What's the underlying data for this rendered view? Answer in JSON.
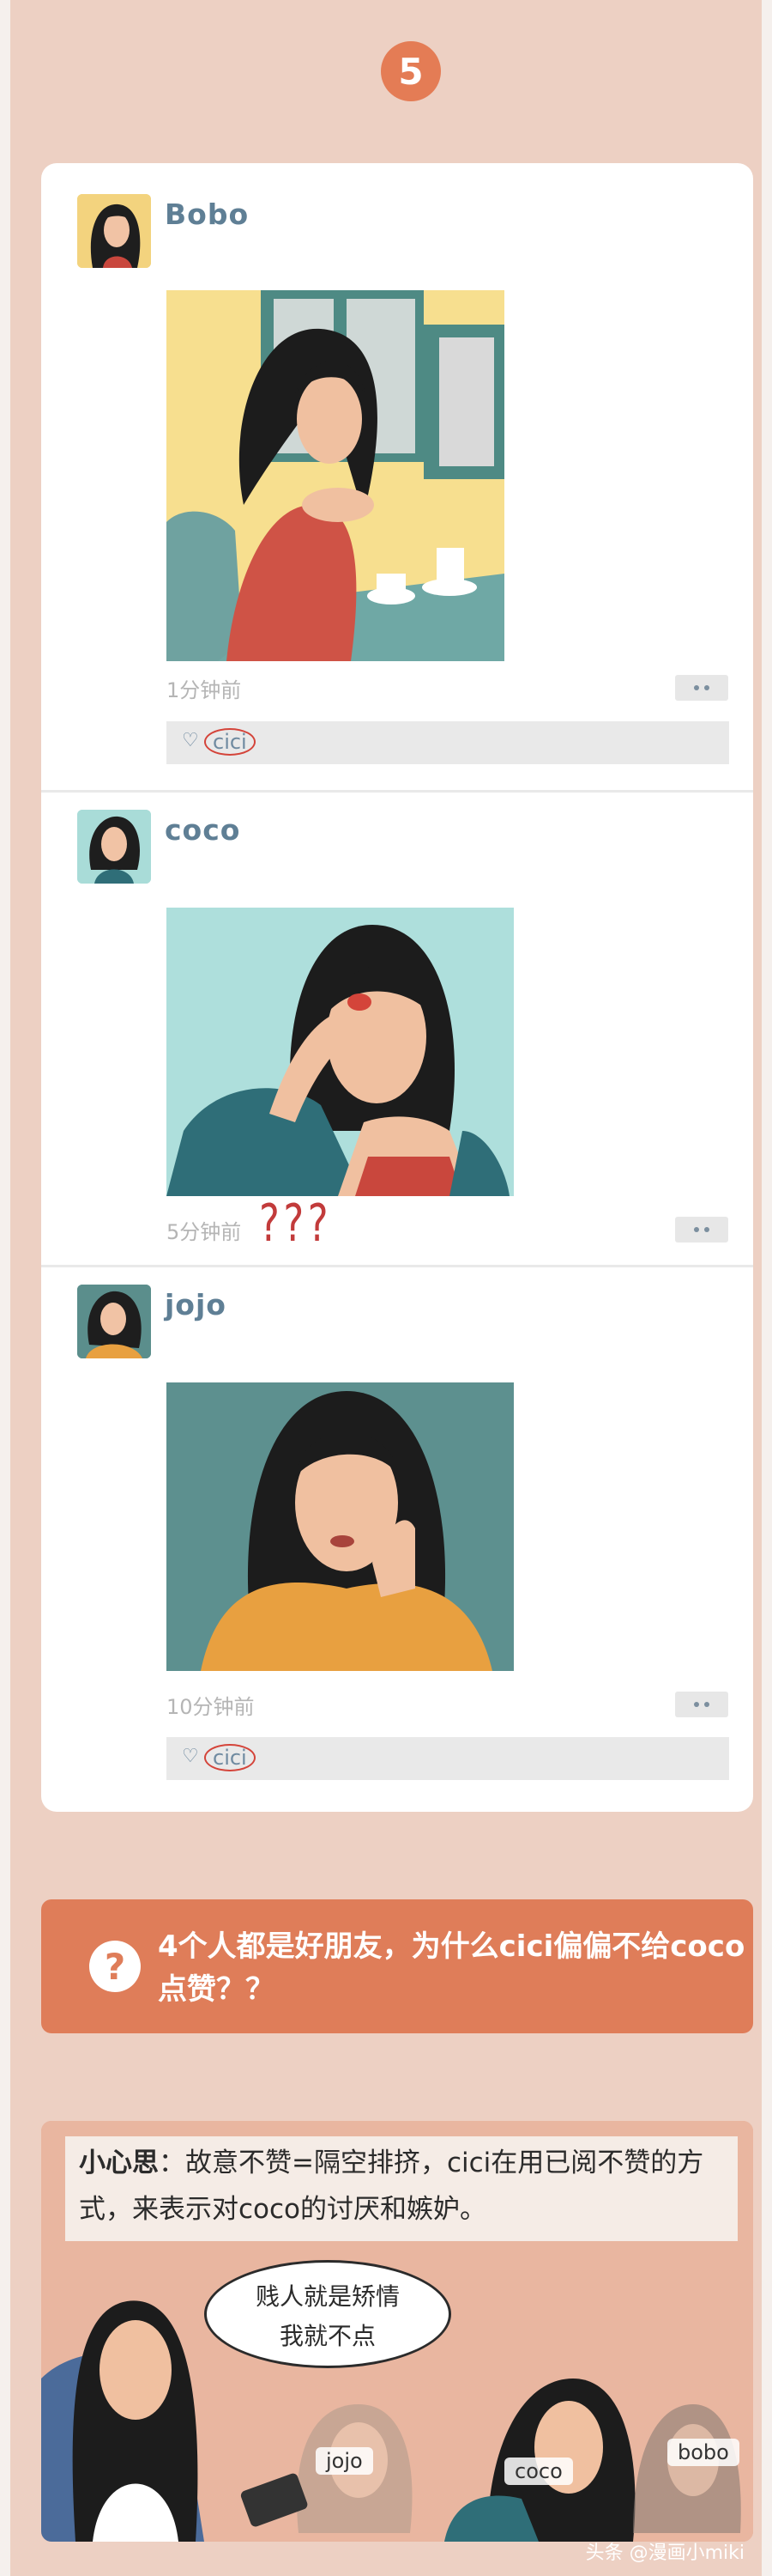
{
  "step_number": "5",
  "posts": [
    {
      "name": "Bobo",
      "time": "1分钟前",
      "likers": [
        "cici"
      ]
    },
    {
      "name": "coco",
      "time": "5分钟前",
      "likers": []
    },
    {
      "name": "jojo",
      "time": "10分钟前",
      "likers": [
        "cici"
      ]
    }
  ],
  "annotation_marks": "???",
  "question": "4个人都是好朋友，为什么cici偏偏不给coco点赞？？",
  "answer": {
    "title": "小心思",
    "separator": "：",
    "text": "故意不赞=隔空排挤，cici在用已阅不赞的方式，来表示对coco的讨厌和嫉妒。",
    "speech_line1": "贱人就是矫情",
    "speech_line2": "我就不点",
    "tags": [
      "jojo",
      "coco",
      "bobo"
    ]
  },
  "watermark": "头条 @漫画小miki",
  "colors": {
    "accent": "#df7d59",
    "name": "#5f7f95",
    "background": "#edd0c3"
  }
}
